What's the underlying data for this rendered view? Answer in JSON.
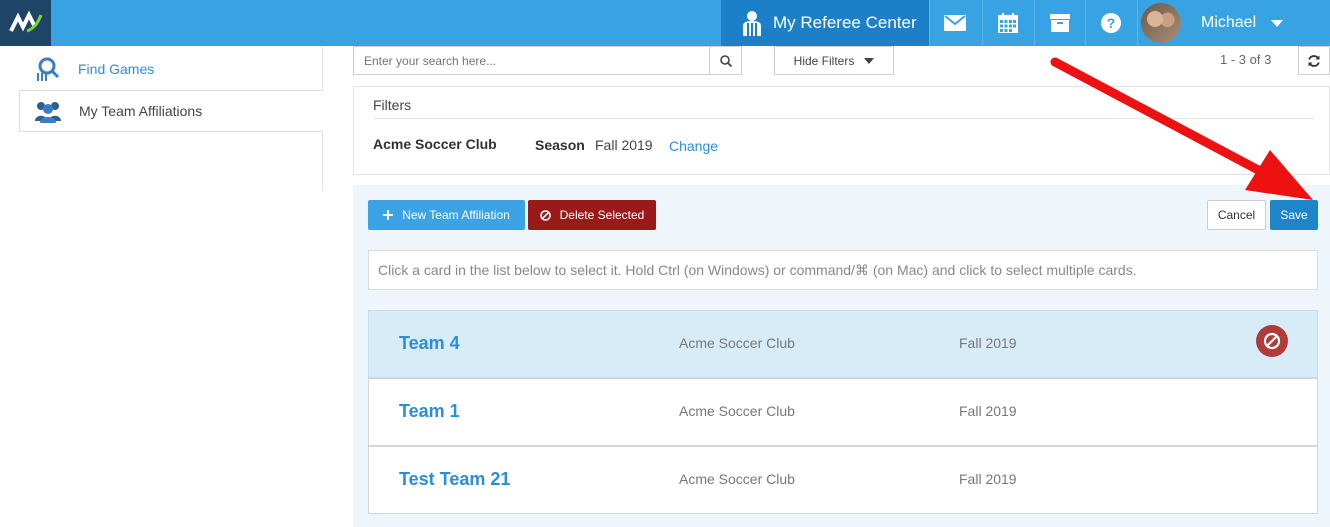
{
  "header": {
    "referee_center_label": "My Referee Center",
    "user_name": "Michael",
    "nav_icons": [
      "envelope-icon",
      "calendar-icon",
      "archive-icon",
      "help-icon"
    ]
  },
  "sidebar": {
    "items": [
      {
        "label": "Find Games",
        "icon": "find-games-icon"
      },
      {
        "label": "My Team Affiliations",
        "icon": "team-affiliations-icon"
      }
    ]
  },
  "toolbar": {
    "search_placeholder": "Enter your search here...",
    "hide_filters_label": "Hide Filters",
    "pager": "1 - 3 of 3"
  },
  "filters": {
    "title": "Filters",
    "club": "Acme Soccer Club",
    "season_label": "Season",
    "season_value": "Fall 2019",
    "change_label": "Change"
  },
  "actions": {
    "new_label": "New Team Affiliation",
    "delete_label": "Delete Selected",
    "cancel_label": "Cancel",
    "save_label": "Save"
  },
  "hint": "Click a card in the list below to select it. Hold Ctrl (on Windows) or command/⌘ (on Mac) and click to select multiple cards.",
  "teams": [
    {
      "name": "Team 4",
      "club": "Acme Soccer Club",
      "season": "Fall 2019",
      "selected": true
    },
    {
      "name": "Team 1",
      "club": "Acme Soccer Club",
      "season": "Fall 2019",
      "selected": false
    },
    {
      "name": "Test Team 21",
      "club": "Acme Soccer Club",
      "season": "Fall 2019",
      "selected": false
    }
  ],
  "colors": {
    "topbar": "#37a3e3",
    "referee_tab": "#1b80c8",
    "logo_bg": "#1e4468",
    "delete_red": "#9a1a1a",
    "save_blue": "#1e86c8",
    "link_blue": "#2b8ed6",
    "annotation_arrow": "#ee1111"
  }
}
